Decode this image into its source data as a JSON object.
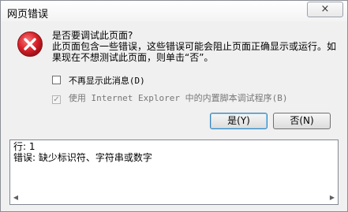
{
  "window": {
    "title": "网页错误",
    "close_icon": "×"
  },
  "dialog": {
    "heading": "是否要调试此页面?",
    "description": "此页面包含一些错误，这些错误可能会阻止页面正确显示或运行。如果现在不想测试此页面，则单击“否”。",
    "checkbox_dont_show": {
      "label": "不再显示此消息(D)",
      "checked": false
    },
    "checkbox_use_debugger": {
      "label": "使用 Internet Explorer 中的内置脚本调试程序(B)",
      "checked": true,
      "disabled": true,
      "check_glyph": "✓"
    },
    "yes_button": "是(Y)",
    "no_button": "否(N)"
  },
  "details": {
    "line_label": "行: 1",
    "error_label": "错误: 缺少标识符、字符串或数字",
    "scroll_left_icon": "◀",
    "scroll_right_icon": "▶"
  },
  "colors": {
    "error_icon": "#d9222a",
    "default_button_border": "#3c7fb1"
  }
}
